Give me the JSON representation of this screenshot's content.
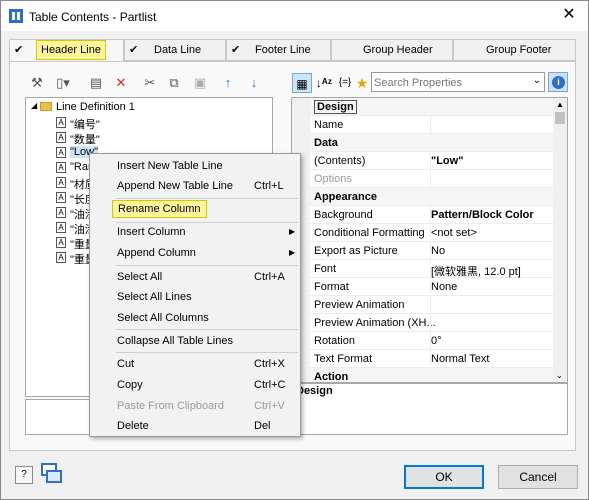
{
  "window": {
    "title": "Table Contents - Partlist"
  },
  "tabs": [
    {
      "label": "Header Line",
      "checked": true
    },
    {
      "label": "Data Line",
      "checked": true
    },
    {
      "label": "Footer Line",
      "checked": true
    },
    {
      "label": "Group Header",
      "checked": false
    },
    {
      "label": "Group Footer",
      "checked": false
    }
  ],
  "tree": {
    "root": {
      "label": "Line Definition  1"
    },
    "items": [
      "\"编号\"",
      "\"数量\"",
      "\"Low\"",
      "\"Ran",
      "\"材质",
      "\"长度",
      "\"油漆",
      "\"油漆",
      "\"重量",
      "\"重量"
    ],
    "check_mark": "✔"
  },
  "search": {
    "placeholder": "Search Properties"
  },
  "properties": {
    "rows": [
      {
        "kind": "cat",
        "name": "Design",
        "value": ""
      },
      {
        "kind": "prop",
        "name": "Name",
        "value": ""
      },
      {
        "kind": "cat",
        "name": "Data",
        "value": ""
      },
      {
        "kind": "prop",
        "name": "(Contents)",
        "value": "\"Low\"",
        "bold": true
      },
      {
        "kind": "prop",
        "name": "Options",
        "value": "",
        "disabled": true
      },
      {
        "kind": "cat",
        "name": "Appearance",
        "value": ""
      },
      {
        "kind": "prop",
        "name": "Background",
        "value": "Pattern/Block Color",
        "bold": true
      },
      {
        "kind": "prop",
        "name": "Conditional Formatting",
        "value": "<not set>"
      },
      {
        "kind": "prop",
        "name": "Export as Picture",
        "value": "No"
      },
      {
        "kind": "prop",
        "name": "Font",
        "value": "[微软雅黑, 12.0 pt]"
      },
      {
        "kind": "prop",
        "name": "Format",
        "value": "None"
      },
      {
        "kind": "prop",
        "name": "Preview Animation",
        "value": ""
      },
      {
        "kind": "prop",
        "name": "Preview Animation (XH...",
        "value": ""
      },
      {
        "kind": "prop",
        "name": "Rotation",
        "value": "0°"
      },
      {
        "kind": "prop",
        "name": "Text Format",
        "value": "Normal Text"
      },
      {
        "kind": "cat",
        "name": "Action",
        "value": ""
      }
    ],
    "description_title": "Design"
  },
  "context_menu": {
    "items": [
      {
        "label": "Insert New Table Line",
        "shortcut": ""
      },
      {
        "label": "Append New Table Line",
        "shortcut": "Ctrl+L"
      },
      {
        "sep": true
      },
      {
        "label": "Rename Column",
        "shortcut": "",
        "highlight": true
      },
      {
        "sep": true
      },
      {
        "label": "Insert Column",
        "shortcut": "",
        "submenu": true
      },
      {
        "label": "Append Column",
        "shortcut": "",
        "submenu": true
      },
      {
        "sep": true
      },
      {
        "label": "Select All",
        "shortcut": "Ctrl+A"
      },
      {
        "label": "Select All Lines",
        "shortcut": ""
      },
      {
        "label": "Select All Columns",
        "shortcut": ""
      },
      {
        "sep": true
      },
      {
        "label": "Collapse All Table Lines",
        "shortcut": ""
      },
      {
        "sep": true
      },
      {
        "label": "Cut",
        "shortcut": "Ctrl+X"
      },
      {
        "label": "Copy",
        "shortcut": "Ctrl+C"
      },
      {
        "label": "Paste From Clipboard",
        "shortcut": "Ctrl+V",
        "disabled": true
      },
      {
        "label": "Delete",
        "shortcut": "Del"
      }
    ]
  },
  "buttons": {
    "ok": "OK",
    "cancel": "Cancel",
    "help": "?"
  },
  "colors": {
    "highlight": "#fff59a",
    "accent": "#0078d7",
    "selection": "#cce4f7"
  }
}
